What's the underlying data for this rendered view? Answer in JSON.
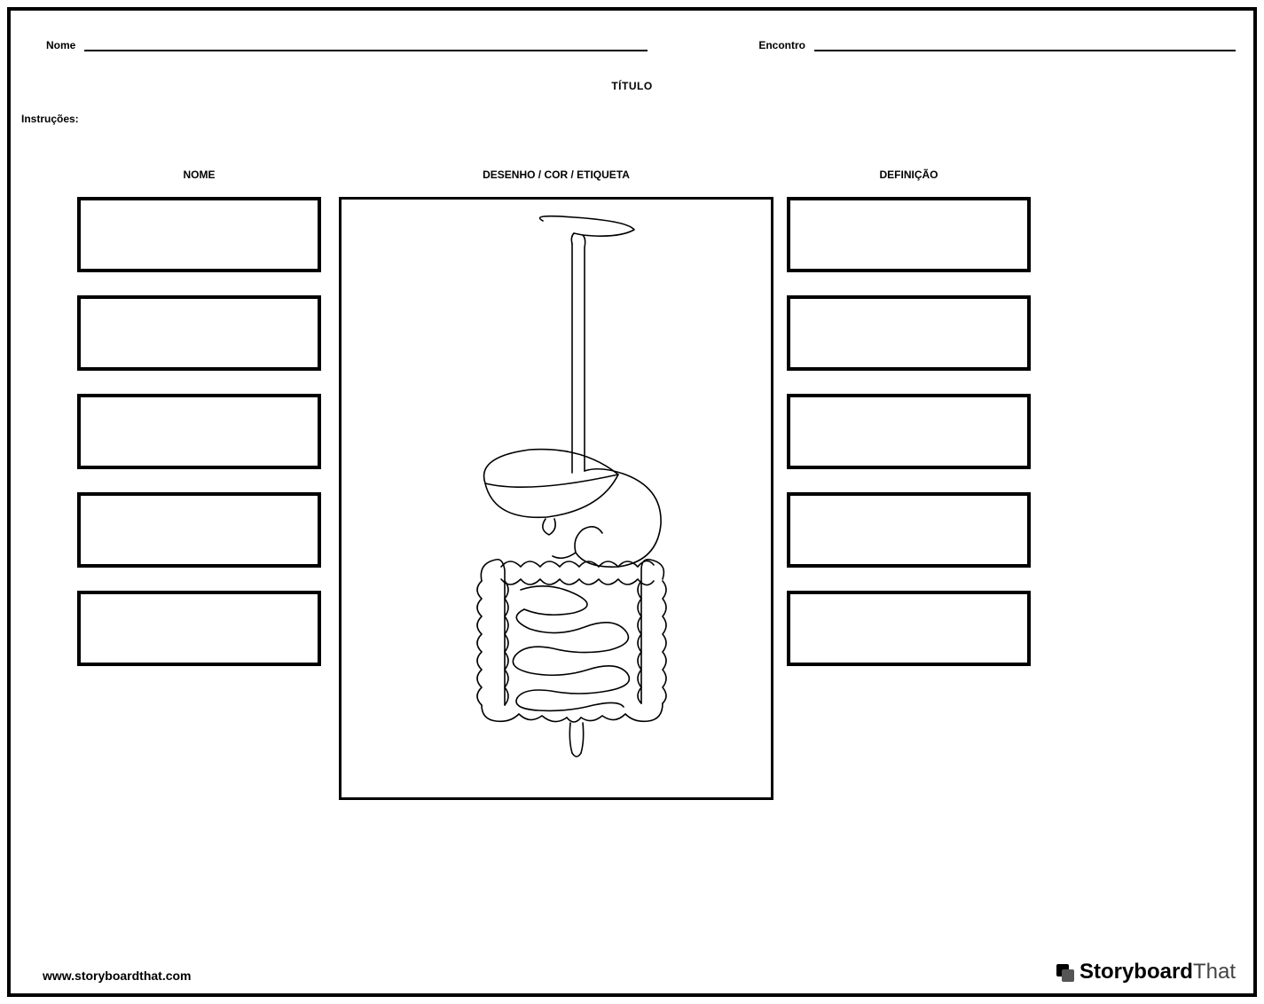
{
  "header": {
    "name_label": "Nome",
    "date_label": "Encontro"
  },
  "title": "TÍTULO",
  "instructions_label": "Instruções:",
  "columns": {
    "left": "NOME",
    "center": "DESENHO / COR / ETIQUETA",
    "right": "DEFINIÇÃO"
  },
  "footer": {
    "url": "www.storyboardthat.com",
    "logo_bold": "Storyboard",
    "logo_light": "That"
  }
}
